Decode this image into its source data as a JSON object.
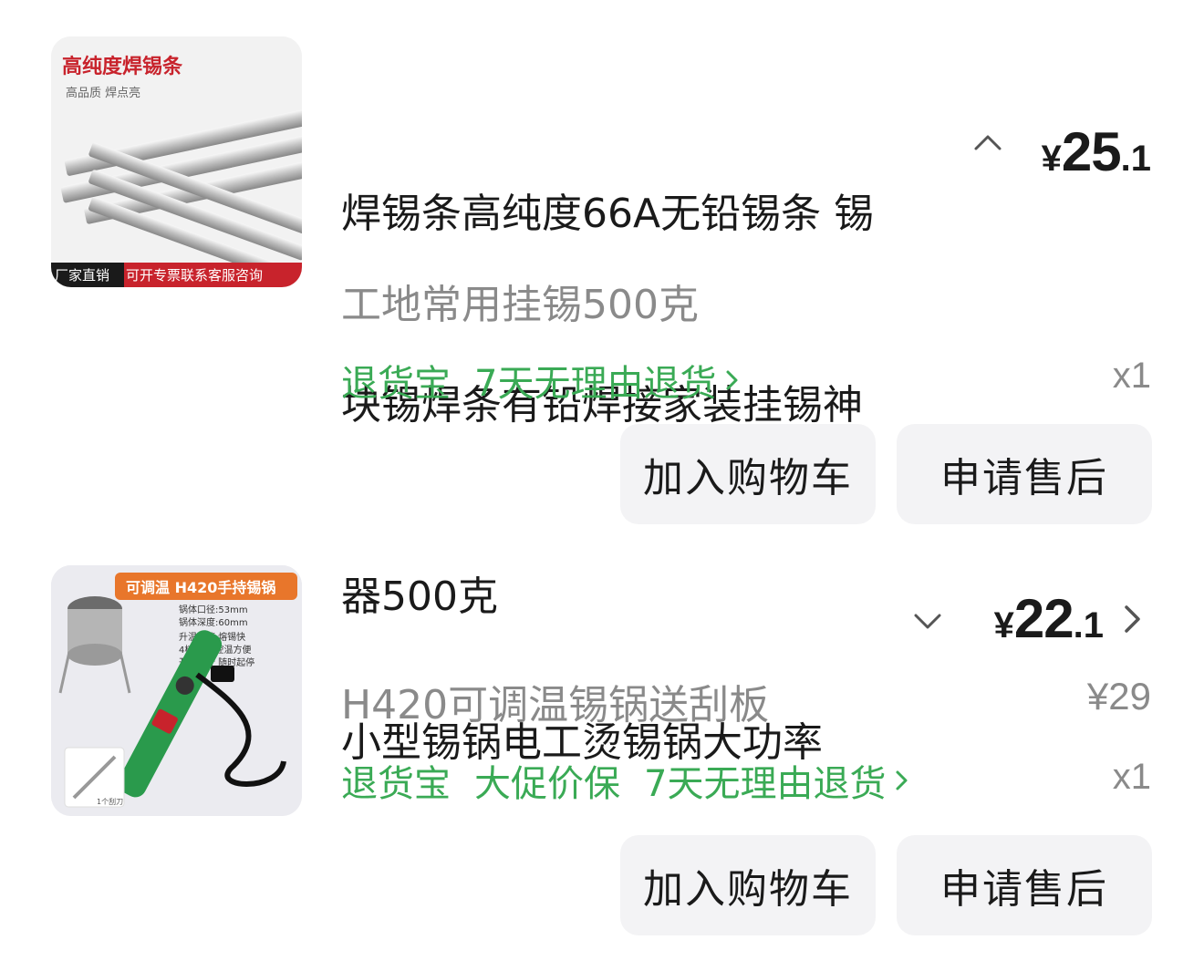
{
  "items": [
    {
      "thumb": {
        "headline": "高纯度焊锡条",
        "subline": "高品质 焊点亮",
        "banner_left": "厂家直销",
        "banner_right": "可开专票联系客服咨询"
      },
      "title": "焊锡条高纯度66A无铅锡条 锡块锡焊条有铅焊接家装挂锡神器500克",
      "title_lines": [
        "焊锡条高纯度66A无铅锡条 锡",
        "块锡焊条有铅焊接家装挂锡神",
        "器500克"
      ],
      "toggle_icon": "chevron-up-icon",
      "price": {
        "currency": "¥",
        "integer": "25",
        "decimal": ".1"
      },
      "spec": "工地常用挂锡500克",
      "services": [
        "退货宝",
        "7天无理由退货"
      ],
      "quantity": "x1",
      "actions": {
        "add_to_cart": "加入购物车",
        "after_sales": "申请售后"
      }
    },
    {
      "thumb": {
        "headline": "可调温 H420手持锡锅",
        "specs": [
          "锅体口径:53mm",
          "锅体深度:60mm",
          "升温迅速 熔锡快",
          "4档可调 控温方便",
          "开关设计 随时起停"
        ],
        "accessory_label": "1个刮刀"
      },
      "title": "小型锡锅电工烫锡锅大功率",
      "toggle_icon": "chevron-down-icon",
      "price": {
        "currency": "¥",
        "integer": "22",
        "decimal": ".1"
      },
      "original_price": "¥29",
      "spec": "H420可调温锡锅送刮板",
      "services": [
        "退货宝",
        "大促价保",
        "7天无理由退货"
      ],
      "quantity": "x1",
      "actions": {
        "add_to_cart": "加入购物车",
        "after_sales": "申请售后"
      }
    }
  ],
  "colors": {
    "service_green": "#3aaa55",
    "muted_text": "#8a8a8a",
    "button_bg": "#f3f3f5",
    "banner_red": "#c8232c"
  }
}
